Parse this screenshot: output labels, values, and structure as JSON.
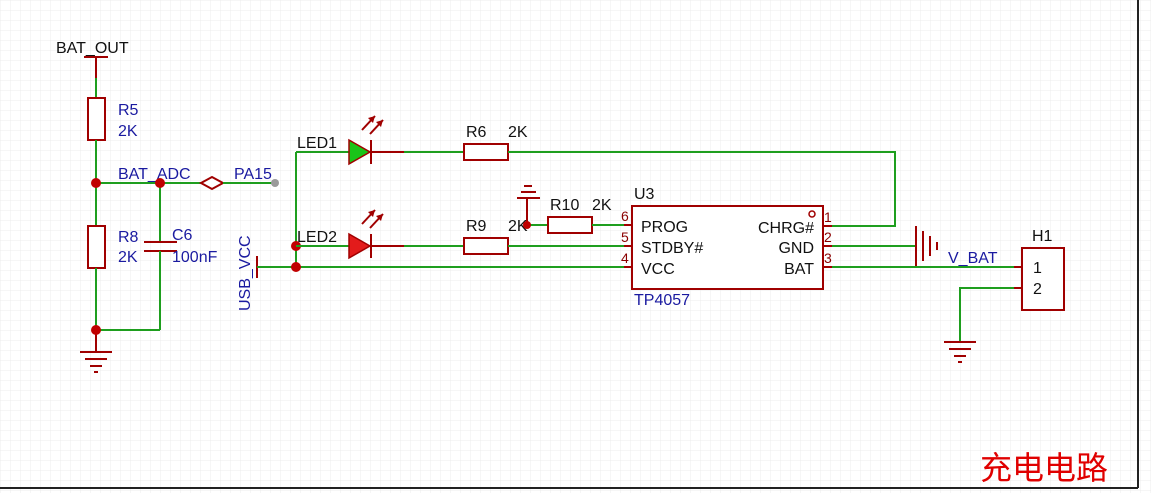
{
  "title": "充电电路",
  "nets": {
    "bat_out": "BAT_OUT",
    "bat_adc": "BAT_ADC",
    "pa15": "PA15",
    "usb_vcc": "USB_VCC",
    "v_bat": "V_BAT"
  },
  "components": {
    "r5": {
      "ref": "R5",
      "value": "2K"
    },
    "r8": {
      "ref": "R8",
      "value": "2K"
    },
    "c6": {
      "ref": "C6",
      "value": "100nF"
    },
    "r6": {
      "ref": "R6",
      "value": "2K"
    },
    "r9": {
      "ref": "R9",
      "value": "2K"
    },
    "r10": {
      "ref": "R10",
      "value": "2K"
    },
    "led1": {
      "ref": "LED1"
    },
    "led2": {
      "ref": "LED2"
    },
    "u3": {
      "ref": "U3",
      "value": "TP4057",
      "pins_left": [
        {
          "num": "6",
          "name": "PROG"
        },
        {
          "num": "5",
          "name": "STDBY#"
        },
        {
          "num": "4",
          "name": "VCC"
        }
      ],
      "pins_right": [
        {
          "num": "1",
          "name": "CHRG#"
        },
        {
          "num": "2",
          "name": "GND"
        },
        {
          "num": "3",
          "name": "BAT"
        }
      ]
    },
    "h1": {
      "ref": "H1",
      "pins": [
        "1",
        "2"
      ]
    }
  }
}
